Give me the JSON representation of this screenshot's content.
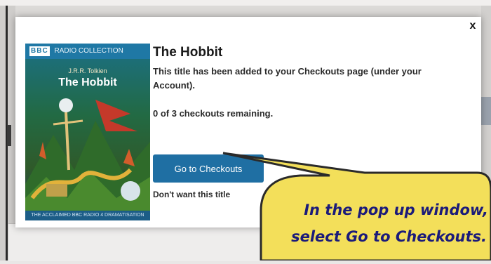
{
  "modal": {
    "close_label": "x",
    "title": "The Hobbit",
    "added_message": "This title has been added to your Checkouts page (under your Account).",
    "remaining": "0 of 3 checkouts remaining.",
    "goto_button": "Go to Checkouts",
    "dont_want": "Don't want this title"
  },
  "cover": {
    "series_badge": "BBC",
    "series_label": "RADIO COLLECTION",
    "author": "J.R.R. Tolkien",
    "title": "The Hobbit",
    "footer": "THE ACCLAIMED BBC RADIO 4 DRAMATISATION"
  },
  "callout": {
    "line1": "In the pop up window,",
    "line2": "select Go to Checkouts."
  },
  "colors": {
    "button": "#1f6fa3",
    "callout_fill": "#f3df5a",
    "callout_text": "#1b1b7a"
  }
}
